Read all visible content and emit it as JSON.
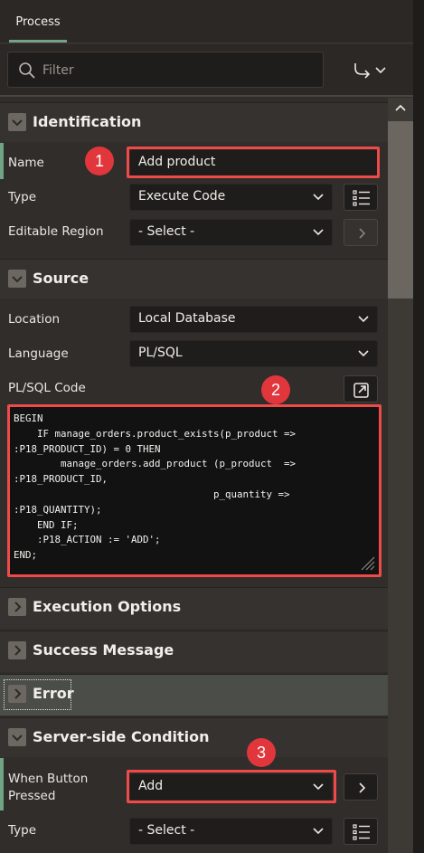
{
  "tabs": [
    {
      "label": "Process",
      "active": true
    }
  ],
  "filter": {
    "placeholder": "Filter"
  },
  "sections": {
    "identification": {
      "title": "Identification",
      "name_label": "Name",
      "name_value": "Add product",
      "type_label": "Type",
      "type_value": "Execute Code",
      "editable_region_label": "Editable Region",
      "editable_region_value": "- Select -"
    },
    "source": {
      "title": "Source",
      "location_label": "Location",
      "location_value": "Local Database",
      "language_label": "Language",
      "language_value": "PL/SQL",
      "code_label": "PL/SQL Code",
      "code": "BEGIN\n    IF manage_orders.product_exists(p_product =>\n:P18_PRODUCT_ID) = 0 THEN\n        manage_orders.add_product (p_product  =>\n:P18_PRODUCT_ID,\n                                  p_quantity =>\n:P18_QUANTITY);\n    END IF;\n    :P18_ACTION := 'ADD';\nEND;"
    },
    "execution_options": {
      "title": "Execution Options"
    },
    "success_message": {
      "title": "Success Message"
    },
    "error": {
      "title": "Error"
    },
    "server_side_condition": {
      "title": "Server-side Condition",
      "when_button_label_line1": "When Button",
      "when_button_label_line2": "Pressed",
      "when_button_value": "Add",
      "type_label": "Type",
      "type_value": "- Select -"
    }
  },
  "annotations": {
    "badge1": "1",
    "badge2": "2",
    "badge3": "3"
  },
  "colors": {
    "accent": "#76a28a",
    "highlight": "#ef4a4a",
    "badge": "#e0363c",
    "background": "#302d2a",
    "field": "#1f1d1b"
  }
}
